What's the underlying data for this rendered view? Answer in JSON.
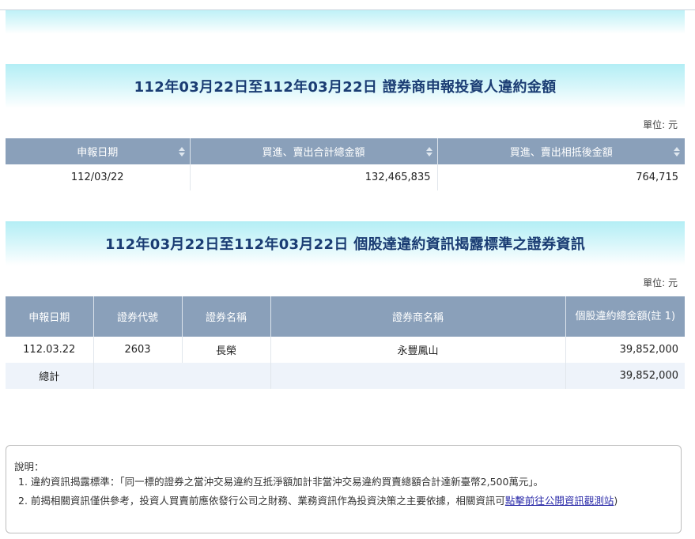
{
  "section1": {
    "title": "112年03月22日至112年03月22日 證券商申報投資人違約金額",
    "unit": "單位: 元",
    "headers": [
      "申報日期",
      "買進、賣出合計總金額",
      "買進、賣出相抵後金額"
    ],
    "rows": [
      [
        "112/03/22",
        "132,465,835",
        "764,715"
      ]
    ]
  },
  "section2": {
    "title": "112年03月22日至112年03月22日 個股達違約資訊揭露標準之證券資訊",
    "unit": "單位: 元",
    "headers": [
      "申報日期",
      "證券代號",
      "證券名稱",
      "證券商名稱",
      "個股違約總金額(註 1)"
    ],
    "rows": [
      [
        "112.03.22",
        "2603",
        "長榮",
        "永豐鳳山",
        "39,852,000"
      ]
    ],
    "total_label": "總計",
    "total_value": "39,852,000"
  },
  "note": {
    "title": "說明：",
    "item1": "1. 違約資訊揭露標準：「同一標的證券之當沖交易違約互抵淨額加計非當沖交易違約買賣總額合計達新臺幣2,500萬元」。",
    "item2_prefix": "2. 前揭相關資訊僅供參考，投資人買賣前應依發行公司之財務、業務資訊作為投資決策之主要依據，相關資訊可",
    "item2_link": "點擊前往公開資訊觀測站",
    "item2_suffix": ")"
  }
}
